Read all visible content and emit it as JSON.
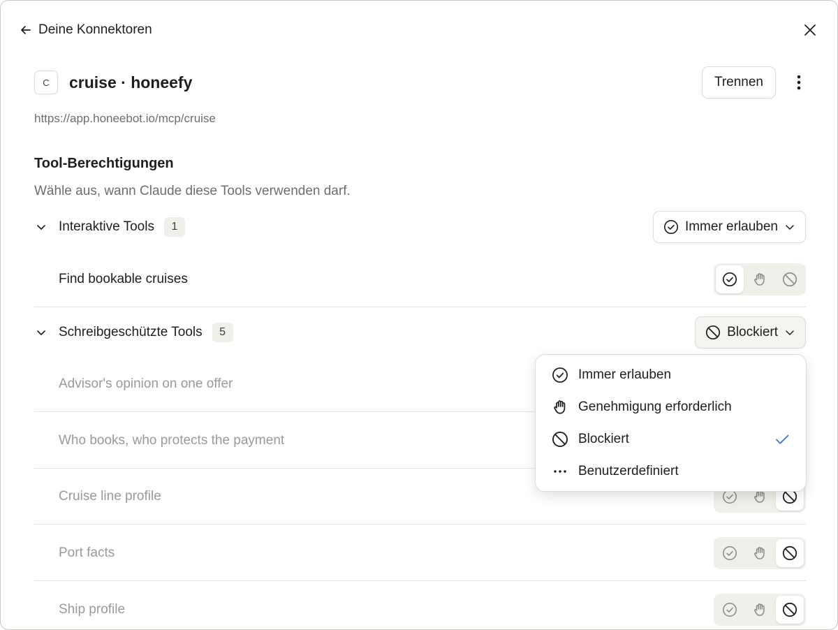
{
  "nav": {
    "back_label": "Deine Konnektoren"
  },
  "connector": {
    "logo_letter": "C",
    "title": "cruise · honeefy",
    "url": "https://app.honeebot.io/mcp/cruise",
    "disconnect_label": "Trennen"
  },
  "permissions": {
    "title": "Tool-Berechtigungen",
    "description": "Wähle aus, wann Claude diese Tools verwenden darf."
  },
  "groups": [
    {
      "name": "Interaktive Tools",
      "count": "1",
      "policy_label": "Immer erlauben",
      "tools": [
        {
          "name": "Find bookable cruises",
          "state": "allow"
        }
      ]
    },
    {
      "name": "Schreibgeschützte Tools",
      "count": "5",
      "policy_label": "Blockiert",
      "tools": [
        {
          "name": "Advisor's opinion on one offer",
          "state": "block"
        },
        {
          "name": "Who books, who protects the payment",
          "state": "block"
        },
        {
          "name": "Cruise line profile",
          "state": "block"
        },
        {
          "name": "Port facts",
          "state": "block"
        },
        {
          "name": "Ship profile",
          "state": "block"
        }
      ]
    }
  ],
  "dropdown": {
    "items": [
      {
        "label": "Immer erlauben",
        "icon": "check-circle-icon",
        "selected": false
      },
      {
        "label": "Genehmigung erforderlich",
        "icon": "hand-icon",
        "selected": false
      },
      {
        "label": "Blockiert",
        "icon": "block-icon",
        "selected": true
      },
      {
        "label": "Benutzerdefiniert",
        "icon": "ellipsis-icon",
        "selected": false
      }
    ]
  },
  "colors": {
    "text": "#1f1e1d",
    "muted": "#6f6e69",
    "faded": "#9b9a95",
    "check_accent": "#3a76d0",
    "segment_bg": "#f0efea"
  }
}
